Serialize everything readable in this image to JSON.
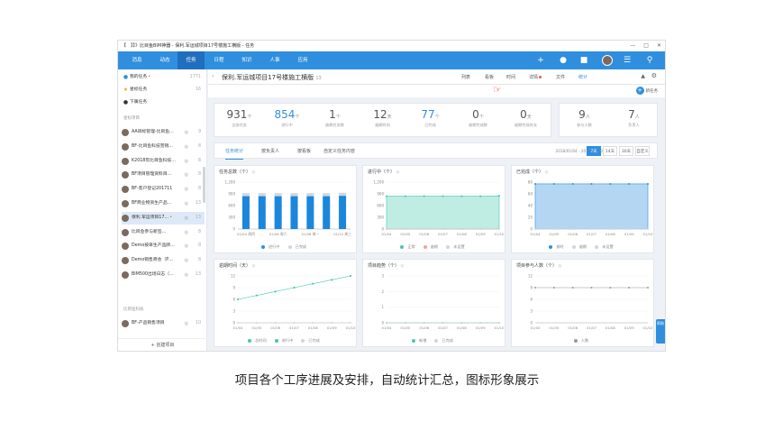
{
  "titlebar": {
    "text": "【　】】》比目鱼BIM神器 - 保利.军运城项目17号楼施工横版 - 任务",
    "min": "—",
    "max": "□",
    "close": "✕"
  },
  "topnav": {
    "items": [
      "消息",
      "动态",
      "任务",
      "日程",
      "知识",
      "人事",
      "应用"
    ],
    "active": 2
  },
  "sidebar": {
    "my_tasks": "我的任务",
    "my_tasks_count": "1771",
    "starred": "星标任务",
    "starred_count": "16",
    "sub": "下属任务",
    "section_projects": "星标项目",
    "projects": [
      {
        "name": "AA目标管理-比目鱼…",
        "count": "9"
      },
      {
        "name": "BF-比目鱼科技营销…",
        "count": "8"
      },
      {
        "name": "K2018年比目鱼科技…",
        "count": "8"
      },
      {
        "name": "BF项目管理资料目…",
        "count": "8"
      },
      {
        "name": "BF-客户登记201711",
        "count": "8"
      },
      {
        "name": "BF商业物资生产品…",
        "count": "13"
      },
      {
        "name": "保利.军运项目17…",
        "count": "13",
        "selected": true
      },
      {
        "name": "比目鱼参与新签…",
        "count": "8"
      },
      {
        "name": "Demo按单生产品牌…",
        "count": "8"
      },
      {
        "name": "Demo销售商会（P…",
        "count": "8"
      },
      {
        "name": "BIM500出场日志（…",
        "count": "13"
      }
    ],
    "section_company": "比目鱼科技",
    "company_projects": [
      {
        "name": "BF-产品销售项目",
        "count": "10"
      }
    ],
    "new_project": "+ 创建项目"
  },
  "project": {
    "name": "保利.军运城项目17号楼施工横版",
    "count": "13",
    "tabs": [
      "列表",
      "看板",
      "时间",
      "详情",
      "文件",
      "统计"
    ],
    "active_tab": 5,
    "new_task": "新任务"
  },
  "stats": [
    {
      "value": "931",
      "unit": "个",
      "label": "全部任务"
    },
    {
      "value": "854",
      "unit": "个",
      "label": "进行中",
      "blue": true
    },
    {
      "value": "1",
      "unit": "个",
      "label": "逾期任务数"
    },
    {
      "value": "12",
      "unit": "天",
      "label": "逾期时间"
    },
    {
      "value": "77",
      "unit": "个",
      "label": "已完成",
      "blue": true
    },
    {
      "value": "0",
      "unit": "个",
      "label": "逾期完成数"
    },
    {
      "value": "0",
      "unit": "天",
      "label": "逾期完成时长"
    }
  ],
  "people": [
    {
      "value": "9",
      "unit": "人",
      "label": "参与人数"
    },
    {
      "value": "7",
      "unit": "人",
      "label": "负责人"
    }
  ],
  "card_tabs": [
    "任务统计",
    "按负责人",
    "按看板",
    "自定义任务内容"
  ],
  "date_range": "2018/01/04 - 2018/01/10",
  "range_buttons": [
    "7天",
    "14天",
    "30天",
    "自定义"
  ],
  "colors": {
    "blue": "#2f8fde",
    "teal": "#4cc4b0",
    "gray": "#cfd6de",
    "nav": "#2f8fde"
  },
  "chart_data": [
    {
      "type": "bar",
      "title": "任务总数（个）",
      "categories": [
        "01/04 周四",
        "01/05 周五",
        "01/06 周六",
        "01/07 周日",
        "01/08 周一",
        "01/09 周二",
        "01/10 周三"
      ],
      "ylim": [
        0,
        1200
      ],
      "yticks": [
        "1,200",
        "900",
        "600",
        "300",
        "0"
      ],
      "series": [
        {
          "name": "进行中",
          "values": [
            840,
            840,
            840,
            840,
            840,
            840,
            850
          ]
        },
        {
          "name": "已完成",
          "values": [
            77,
            77,
            77,
            77,
            77,
            77,
            77
          ]
        }
      ]
    },
    {
      "type": "area",
      "title": "进行中（个）",
      "categories": [
        "01/04",
        "01/05",
        "01/06",
        "01/07",
        "01/08",
        "01/09",
        "01/10"
      ],
      "ylim": [
        0,
        1200
      ],
      "yticks": [
        "1,200",
        "900",
        "600",
        "300",
        "0"
      ],
      "series": [
        {
          "name": "正常",
          "values": [
            840,
            840,
            840,
            840,
            840,
            840,
            850
          ]
        },
        {
          "name": "逾期",
          "values": [
            1,
            1,
            1,
            1,
            1,
            1,
            1
          ]
        },
        {
          "name": "未设置",
          "values": [
            0,
            0,
            0,
            0,
            0,
            0,
            0
          ]
        }
      ]
    },
    {
      "type": "area",
      "title": "已完成（个）",
      "categories": [
        "01/04",
        "01/05",
        "01/06",
        "01/07",
        "01/08",
        "01/09",
        "01/10"
      ],
      "ylim": [
        0,
        80
      ],
      "yticks": [
        "80",
        "60",
        "40",
        "20",
        "0"
      ],
      "series": [
        {
          "name": "按时",
          "values": [
            77,
            77,
            77,
            77,
            77,
            77,
            77
          ]
        },
        {
          "name": "逾期",
          "values": [
            0,
            0,
            0,
            0,
            0,
            0,
            0
          ]
        },
        {
          "name": "未设置",
          "values": [
            0,
            0,
            0,
            0,
            0,
            0,
            0
          ]
        }
      ]
    },
    {
      "type": "line",
      "title": "逾期时间（天）",
      "categories": [
        "01/04",
        "01/05",
        "01/06",
        "01/07",
        "01/08",
        "01/09",
        "01/10"
      ],
      "ylim": [
        0,
        12
      ],
      "yticks": [
        "12",
        "9",
        "6",
        "3",
        "0"
      ],
      "series": [
        {
          "name": "总时间",
          "values": [
            6,
            7,
            8,
            9,
            10,
            11,
            12
          ]
        },
        {
          "name": "进行中",
          "values": [
            6,
            7,
            8,
            9,
            10,
            11,
            12
          ]
        },
        {
          "name": "已完成",
          "values": [
            0,
            0,
            0,
            0,
            0,
            0,
            0
          ]
        }
      ]
    },
    {
      "type": "line",
      "title": "项目趋势（个）",
      "categories": [
        "01/04",
        "01/05",
        "01/06",
        "01/07",
        "01/08",
        "01/09",
        "01/10"
      ],
      "ylim": [
        0,
        3
      ],
      "yticks": [
        "3",
        "2",
        "1",
        "0"
      ],
      "series": [
        {
          "name": "新增",
          "values": [
            0,
            0,
            0,
            0,
            0,
            0,
            0
          ]
        },
        {
          "name": "已完成",
          "values": [
            0,
            0,
            0,
            0,
            0,
            0,
            0
          ]
        }
      ]
    },
    {
      "type": "line",
      "title": "项目参与人数（个）",
      "categories": [
        "01/04",
        "01/05",
        "01/06",
        "01/07",
        "01/08",
        "01/09",
        "01/10"
      ],
      "ylim": [
        0,
        12
      ],
      "yticks": [
        "12",
        "9",
        "6",
        "3",
        "0"
      ],
      "series": [
        {
          "name": "人数",
          "values": [
            9,
            9,
            9,
            9,
            9,
            9,
            9
          ]
        }
      ]
    }
  ],
  "help": "帮助",
  "caption": "项目各个工序进展及安排，自动统计汇总，图标形象展示"
}
